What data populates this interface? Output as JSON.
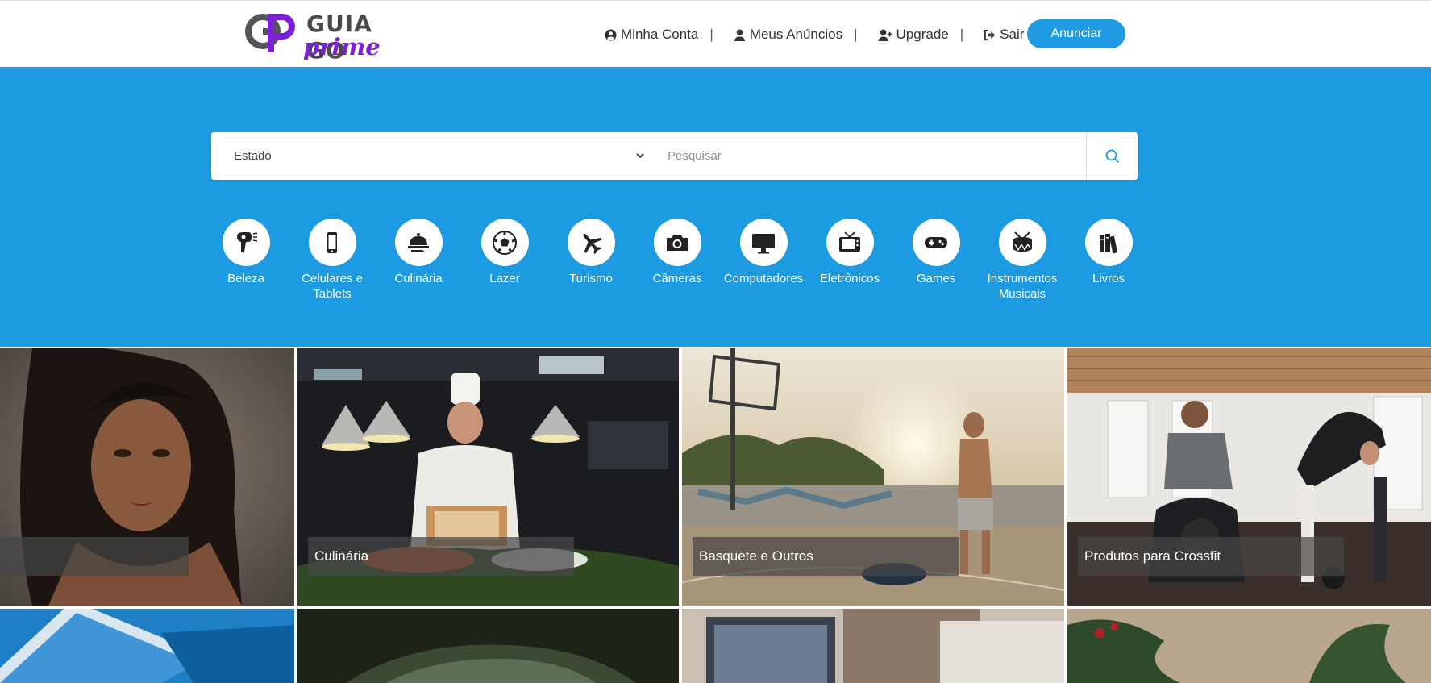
{
  "header": {
    "logo": {
      "brand": "GUIA GO",
      "sub": "prime",
      "monogram": "GP"
    },
    "nav": [
      {
        "label": "Minha Conta",
        "icon": "user-circle-icon"
      },
      {
        "label": "Meus Anúncios",
        "icon": "user-icon"
      },
      {
        "label": "Upgrade",
        "icon": "user-plus-icon"
      },
      {
        "label": "Sair",
        "icon": "sign-out-icon"
      }
    ],
    "separator": "|",
    "cta_label": "Anunciar"
  },
  "search": {
    "estado_label": "Estado",
    "placeholder": "Pesquisar",
    "value": ""
  },
  "categories": [
    {
      "label": "Beleza",
      "icon": "hair-dryer-icon"
    },
    {
      "label": "Celulares e Tablets",
      "icon": "mobile-phone-icon"
    },
    {
      "label": "Culinária",
      "icon": "cloche-icon"
    },
    {
      "label": "Lazer",
      "icon": "soccer-ball-icon"
    },
    {
      "label": "Turismo",
      "icon": "plane-icon"
    },
    {
      "label": "Câmeras",
      "icon": "camera-icon"
    },
    {
      "label": "Computadores",
      "icon": "monitor-icon"
    },
    {
      "label": "Eletrônicos",
      "icon": "tv-icon"
    },
    {
      "label": "Games",
      "icon": "gamepad-icon"
    },
    {
      "label": "Instrumentos Musicais",
      "icon": "drum-icon"
    },
    {
      "label": "Livros",
      "icon": "books-icon"
    }
  ],
  "tiles": [
    {
      "caption": ""
    },
    {
      "caption": "Culinária"
    },
    {
      "caption": "Basquete e Outros"
    },
    {
      "caption": "Produtos para Crossfit"
    },
    {
      "caption": ""
    },
    {
      "caption": ""
    },
    {
      "caption": ""
    },
    {
      "caption": ""
    }
  ],
  "colors": {
    "primary": "#1c9be2",
    "button": "#1e9be2",
    "logo_purple": "#7b1fd8",
    "logo_gray": "#4a4a4a"
  }
}
